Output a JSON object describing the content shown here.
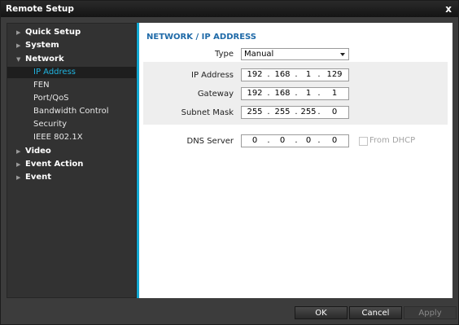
{
  "window": {
    "title": "Remote Setup",
    "close_glyph": "x"
  },
  "sidebar": {
    "items": [
      {
        "label": "Quick Setup",
        "level": 0,
        "arrow": "▶"
      },
      {
        "label": "System",
        "level": 0,
        "arrow": "▶"
      },
      {
        "label": "Network",
        "level": 0,
        "arrow": "▼"
      },
      {
        "label": "IP Address",
        "level": 1,
        "selected": true
      },
      {
        "label": "FEN",
        "level": 1
      },
      {
        "label": "Port/QoS",
        "level": 1
      },
      {
        "label": "Bandwidth Control",
        "level": 1
      },
      {
        "label": "Security",
        "level": 1
      },
      {
        "label": "IEEE 802.1X",
        "level": 1
      },
      {
        "label": "Video",
        "level": 0,
        "arrow": "▶"
      },
      {
        "label": "Event Action",
        "level": 0,
        "arrow": "▶"
      },
      {
        "label": "Event",
        "level": 0,
        "arrow": "▶"
      }
    ]
  },
  "content": {
    "section_title": "NETWORK / IP ADDRESS",
    "type": {
      "label": "Type",
      "value": "Manual"
    },
    "ip_address": {
      "label": "IP Address",
      "octets": [
        "192",
        "168",
        "1",
        "129"
      ]
    },
    "gateway": {
      "label": "Gateway",
      "octets": [
        "192",
        "168",
        "1",
        "1"
      ]
    },
    "subnet_mask": {
      "label": "Subnet Mask",
      "octets": [
        "255",
        "255",
        "255",
        "0"
      ]
    },
    "dns_server": {
      "label": "DNS Server",
      "octets": [
        "0",
        "0",
        "0",
        "0"
      ]
    },
    "from_dhcp": {
      "label": "From DHCP",
      "checked": false,
      "enabled": false
    },
    "dot": "."
  },
  "footer": {
    "ok": "OK",
    "cancel": "Cancel",
    "apply": "Apply"
  },
  "colors": {
    "accent": "#12a8d2",
    "selected_text": "#20b4e0",
    "section_title": "#1f6aa8"
  }
}
